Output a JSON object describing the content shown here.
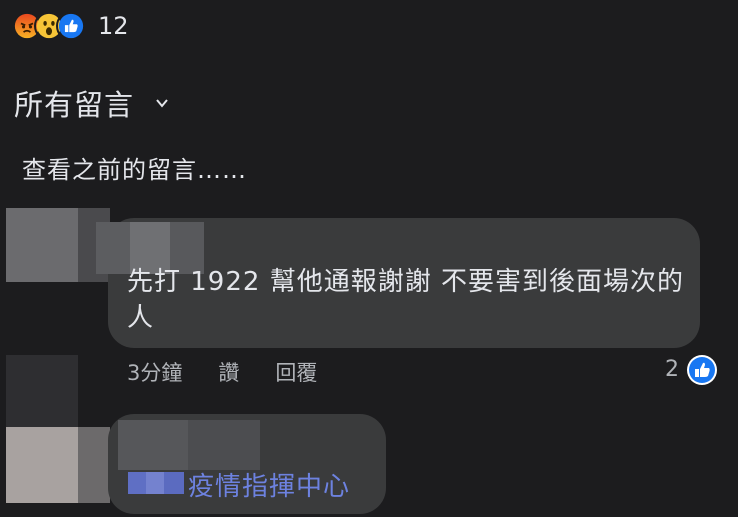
{
  "reactions": {
    "icons": [
      "angry-emoji",
      "wow-emoji",
      "like-thumb"
    ],
    "count": "12"
  },
  "filter": {
    "label": "所有留言"
  },
  "view_previous": "查看之前的留言……",
  "comments": [
    {
      "text": "先打 1922 幫他通報謝謝 不要害到後面場次的人",
      "time": "3分鐘",
      "like_label": "讚",
      "reply_label": "回覆",
      "like_count": "2"
    },
    {
      "link_text": "疫情指揮中心"
    }
  ],
  "colors": {
    "background": "#1c1c1e",
    "bubble": "#3a3b3c",
    "text": "#e4e6eb",
    "muted": "#b0b3b8",
    "link": "#6d82e0",
    "like_blue": "#1877f2"
  }
}
